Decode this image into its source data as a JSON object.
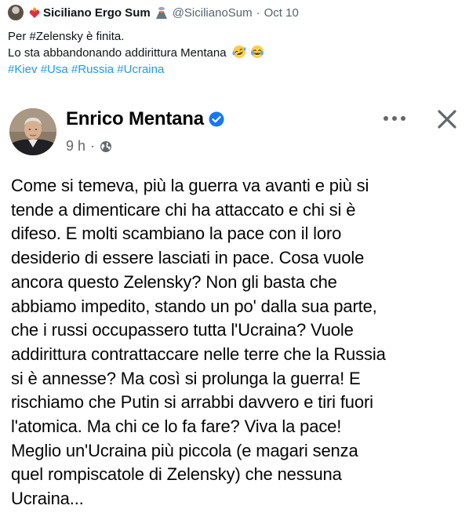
{
  "tweet": {
    "author_name": "Siciliano Ergo Sum",
    "handle": "@SicilianoSum",
    "separator": "·",
    "date": "Oct 10",
    "text_line1": "Per #Zelensky è finita.",
    "text_line2": "Lo sta abbandonando addirittura Mentana",
    "hashtags": [
      "#Kiev",
      "#Usa",
      "#Russia",
      "#Ucraina"
    ],
    "inline_icons": [
      "rolling-on-floor-laughing-icon",
      "tears-of-joy-icon"
    ],
    "header_icons": [
      "avatar",
      "burning-heart-icon",
      "volcano-icon"
    ]
  },
  "facebook_post": {
    "author_name": "Enrico Mentana",
    "time": "9 h",
    "meta_dot": "·",
    "icons": [
      "verified-badge-icon",
      "globe-icon",
      "more-dots-icon",
      "close-icon"
    ],
    "body_lines": [
      "Come si temeva, più la guerra va avanti e più si",
      "tende a dimenticare chi ha attaccato e chi si è",
      "difeso. E molti scambiano la pace con il loro",
      "desiderio di essere lasciati in pace. Cosa vuole",
      "ancora questo Zelensky? Non gli basta che",
      "abbiamo impedito, stando un po' dalla sua parte,",
      "che i russi occupassero tutta l'Ucraina? Vuole",
      "addirittura contrattaccare nelle terre che la Russia",
      "si è annesse? Ma così si prolunga la guerra! E",
      "rischiamo che Putin si arrabbi davvero e tiri fuori",
      "l'atomica. Ma chi ce lo fa fare? Viva la pace!",
      "Meglio un'Ucraina più piccola (e magari senza",
      "quel rompiscatole di Zelensky) che nessuna",
      "Ucraina..."
    ]
  },
  "colors": {
    "twitter_text": "#0f1419",
    "twitter_secondary": "#536471",
    "hashtag_blue": "#1d9bf0",
    "fb_text": "#050505",
    "fb_secondary": "#65676b",
    "verified_blue": "#1877f2"
  }
}
